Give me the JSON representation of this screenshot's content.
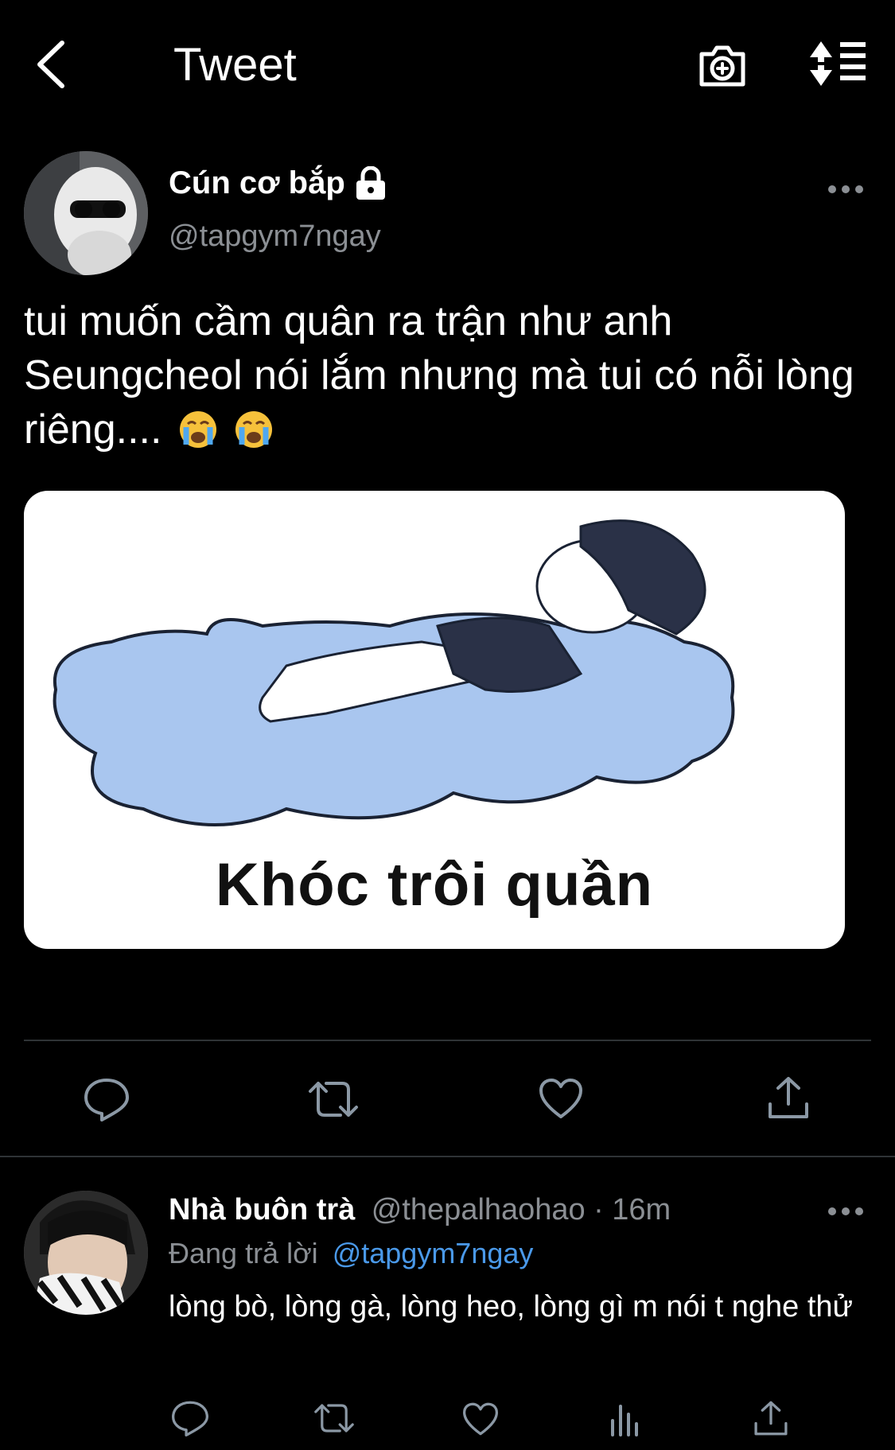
{
  "nav": {
    "title": "Tweet"
  },
  "tweet": {
    "author_name": "Cún cơ bắp",
    "author_handle": "@tapgym7ngay",
    "text": "tui muốn cầm quân ra trận như anh Seungcheol nói lắm nhưng mà tui có nỗi lòng riêng....",
    "emojis": [
      "😭",
      "😭"
    ],
    "media_caption": "Khóc trôi quần"
  },
  "reply": {
    "author_name": "Nhà buôn trà",
    "author_handle": "@thepalhaohao",
    "separator": "·",
    "time": "16m",
    "replying_prefix": "Đang trả lời",
    "replying_to": "@tapgym7ngay",
    "text": "lòng bò, lòng gà, lòng heo, lòng gì m nói t nghe thử"
  },
  "icons": {
    "back": "chevron-left-icon",
    "camera": "camera-plus-icon",
    "sort": "sort-icon",
    "lock": "lock-icon",
    "more": "more-icon",
    "reply": "reply-icon",
    "retweet": "retweet-icon",
    "like": "heart-icon",
    "share": "share-icon",
    "analytics": "analytics-icon"
  },
  "colors": {
    "background": "#000000",
    "muted": "#8b8f94",
    "link": "#4a99e9",
    "divider": "#2f3336"
  }
}
